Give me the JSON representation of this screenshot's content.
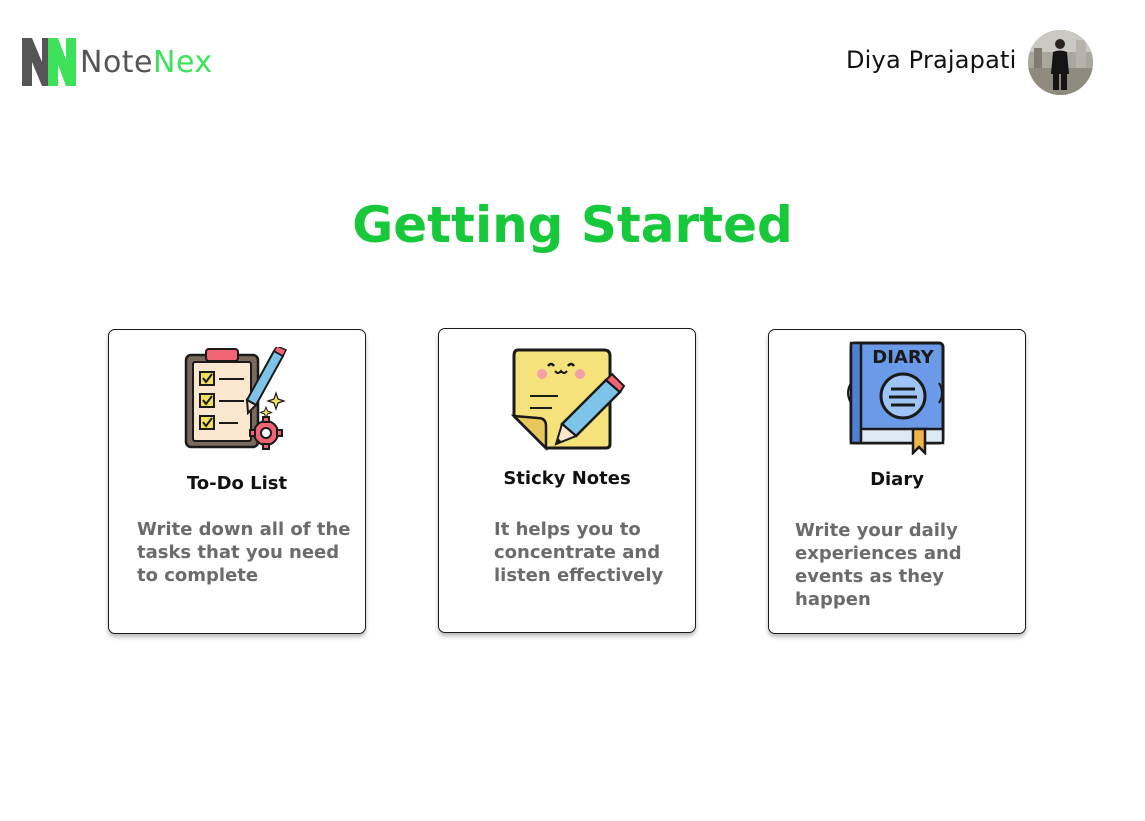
{
  "header": {
    "brand_part1": "Note",
    "brand_part2": "Nex",
    "user_name": "Diya Prajapati"
  },
  "main": {
    "title": "Getting Started"
  },
  "cards": [
    {
      "title": "To-Do List",
      "description": "Write down all of the tasks that you need to complete",
      "icon": "checklist-icon"
    },
    {
      "title": "Sticky Notes",
      "description": "It helps you to concentrate and listen effectively",
      "icon": "sticky-note-icon"
    },
    {
      "title": "Diary",
      "description": "Write your daily experiences and events as they happen",
      "icon": "diary-icon",
      "icon_text": "DIARY"
    }
  ],
  "colors": {
    "brand_green": "#3ee25a",
    "title_green": "#17c93a",
    "logo_gray": "#555555",
    "description_gray": "#6b6b6b"
  }
}
